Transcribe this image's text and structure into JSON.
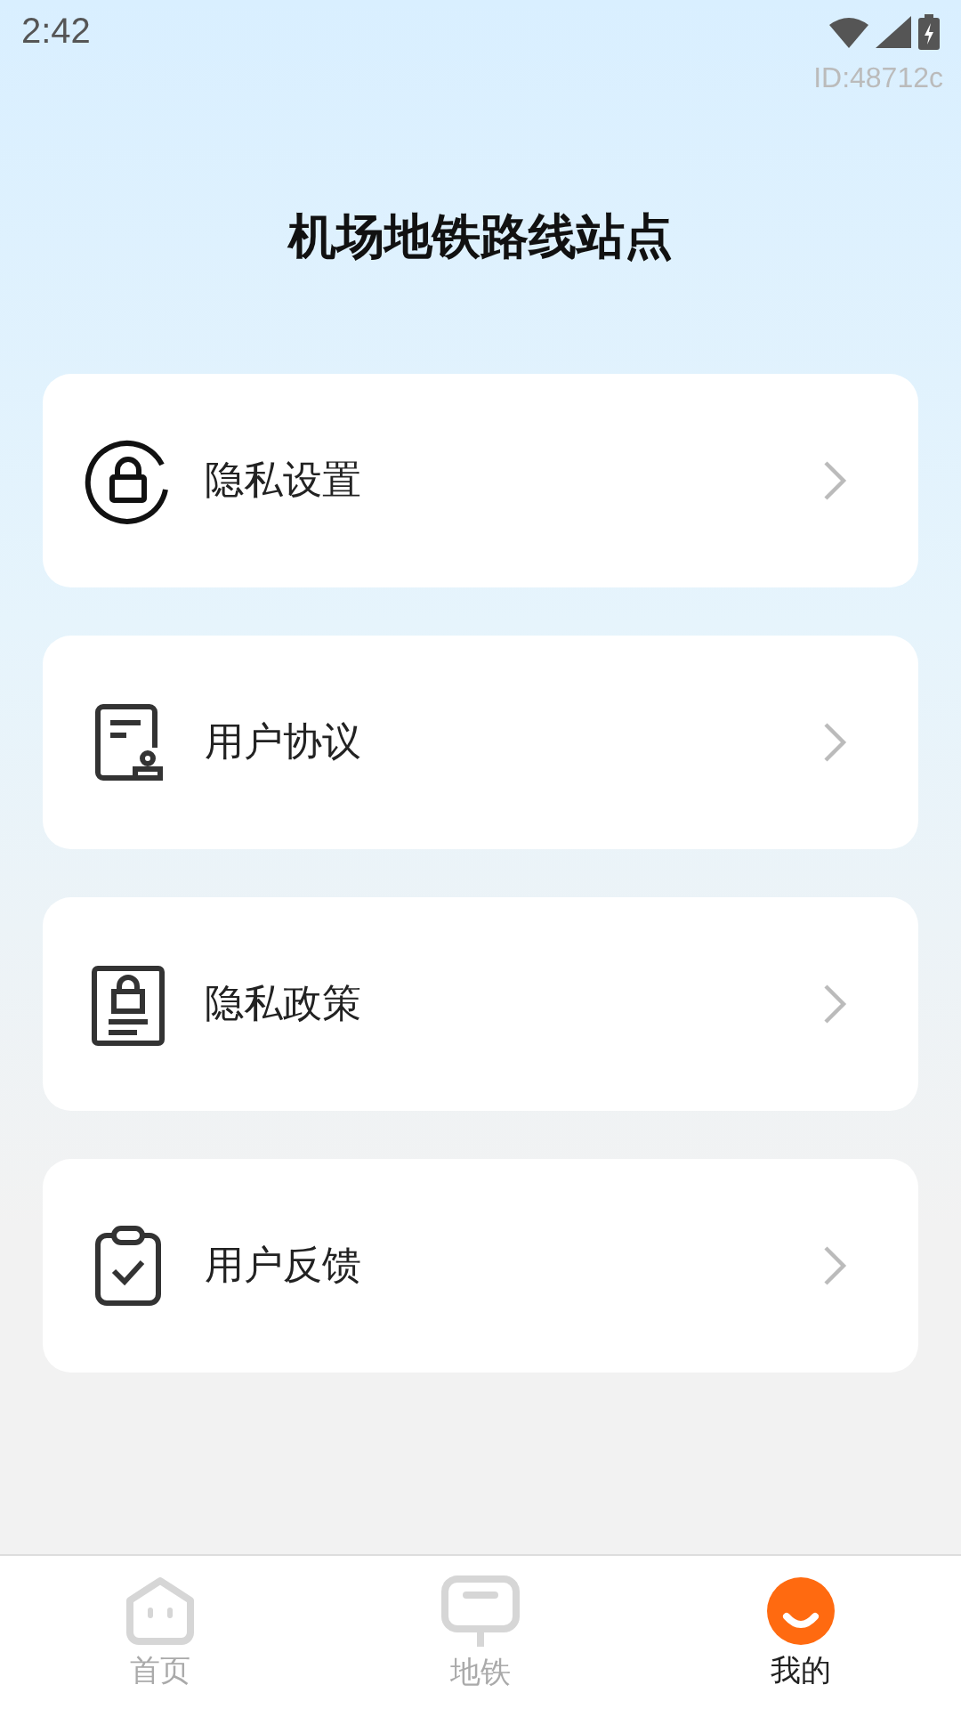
{
  "status_bar": {
    "time": "2:42"
  },
  "user_id": "ID:48712c",
  "title": "机场地铁路线站点",
  "menu": [
    {
      "kind": "privacy-settings",
      "label": "隐私设置"
    },
    {
      "kind": "agreement",
      "label": "用户协议"
    },
    {
      "kind": "policy",
      "label": "隐私政策"
    },
    {
      "kind": "feedback",
      "label": "用户反馈"
    }
  ],
  "tabs": [
    {
      "kind": "home",
      "label": "首页",
      "selected": false
    },
    {
      "kind": "metro",
      "label": "地铁",
      "selected": false
    },
    {
      "kind": "me",
      "label": "我的",
      "selected": true
    }
  ]
}
